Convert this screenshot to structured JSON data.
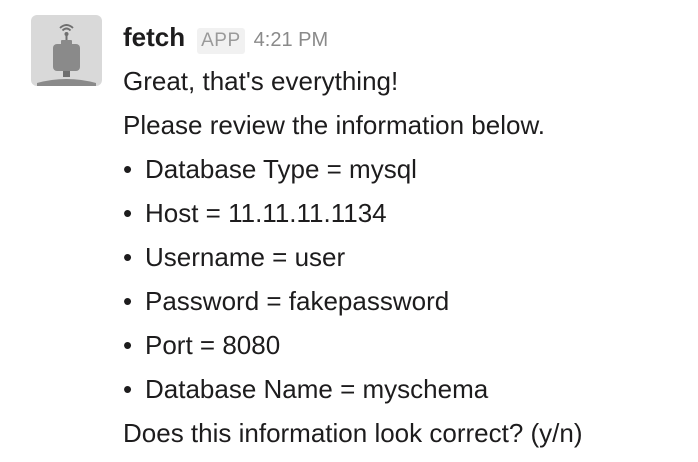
{
  "message": {
    "sender": "fetch",
    "badge": "APP",
    "timestamp": "4:21 PM",
    "avatar_icon": "robot-icon",
    "lines": [
      {
        "text": "Great, that's everything!",
        "bullet": false
      },
      {
        "text": "Please review the information below.",
        "bullet": false
      },
      {
        "text": "Database Type = mysql",
        "bullet": true
      },
      {
        "text": "Host = 11.11.11.1134",
        "bullet": true
      },
      {
        "text": "Username = user",
        "bullet": true
      },
      {
        "text": "Password = fakepassword",
        "bullet": true
      },
      {
        "text": "Port = 8080",
        "bullet": true
      },
      {
        "text": "Database Name = myschema",
        "bullet": true
      },
      {
        "text": "Does this information look correct? (y/n)",
        "bullet": false
      }
    ],
    "bullet_char": "•"
  }
}
